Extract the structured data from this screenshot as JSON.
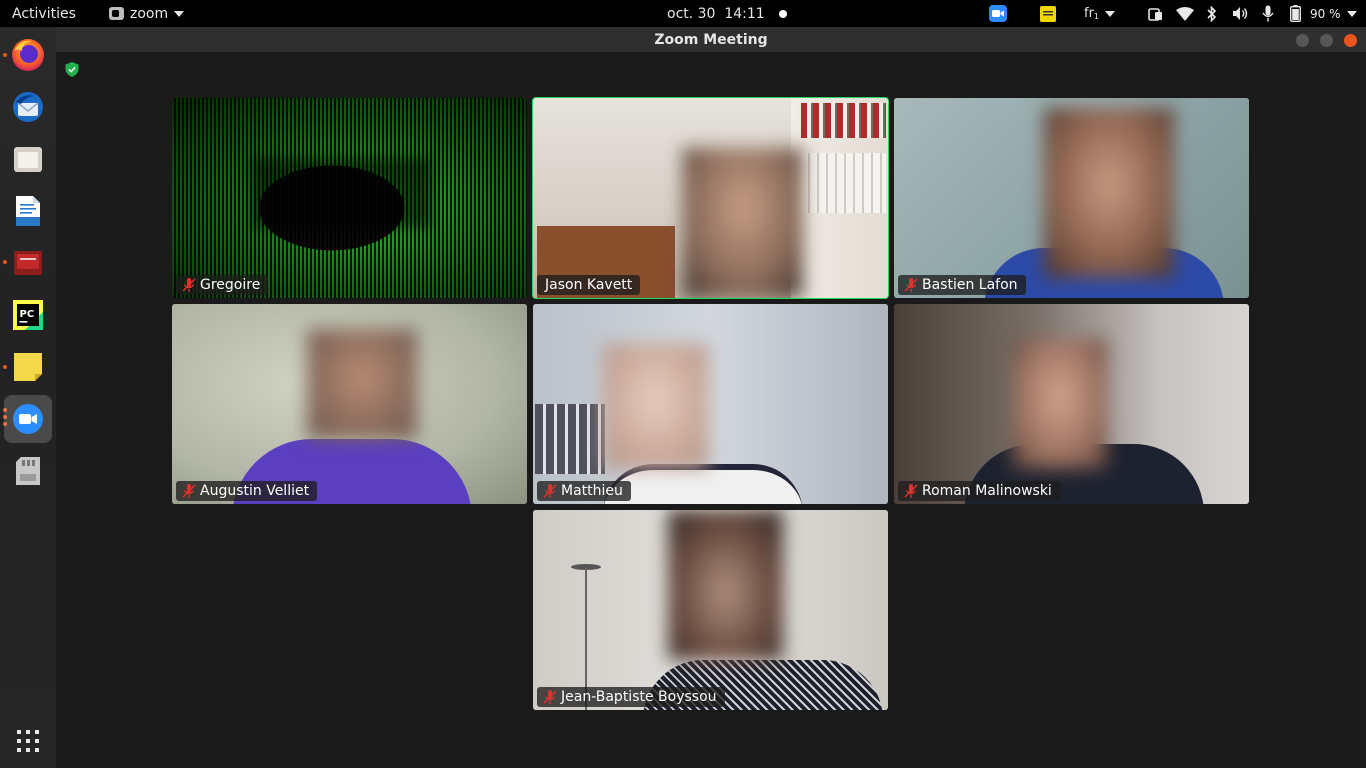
{
  "topbar": {
    "activities_label": "Activities",
    "app_menu_label": "zoom",
    "clock": "oct. 30  14:11",
    "keyboard_layout": "fr",
    "battery_percent": "90 %"
  },
  "window": {
    "title": "Zoom Meeting"
  },
  "dock": {
    "items": [
      {
        "icon": "firefox-icon",
        "running": true
      },
      {
        "icon": "thunderbird-icon",
        "running": false
      },
      {
        "icon": "files-icon",
        "running": false
      },
      {
        "icon": "libreoffice-writer-icon",
        "running": false
      },
      {
        "icon": "presentation-icon",
        "running": true
      },
      {
        "icon": "pycharm-icon",
        "running": false
      },
      {
        "icon": "sticky-notes-icon",
        "running": true
      },
      {
        "icon": "zoom-icon",
        "running": true,
        "active": true
      },
      {
        "icon": "sd-card-icon",
        "running": false
      }
    ],
    "show_apps_icon": "app-grid-icon"
  },
  "participants": [
    {
      "name": "Gregoire",
      "muted": true,
      "speaking": false
    },
    {
      "name": "Jason Kavett",
      "muted": false,
      "speaking": true
    },
    {
      "name": "Bastien Lafon",
      "muted": true,
      "speaking": false
    },
    {
      "name": "Augustin Velliet",
      "muted": true,
      "speaking": false
    },
    {
      "name": "Matthieu",
      "muted": true,
      "speaking": false
    },
    {
      "name": "Roman Malinowski",
      "muted": true,
      "speaking": false
    },
    {
      "name": "Jean-Baptiste Boyssou",
      "muted": true,
      "speaking": false
    }
  ],
  "colors": {
    "speaking_border": "#23d959",
    "mute_red": "#e0322d",
    "encryption_green": "#23b14d",
    "zoom_blue": "#2d8cff"
  }
}
